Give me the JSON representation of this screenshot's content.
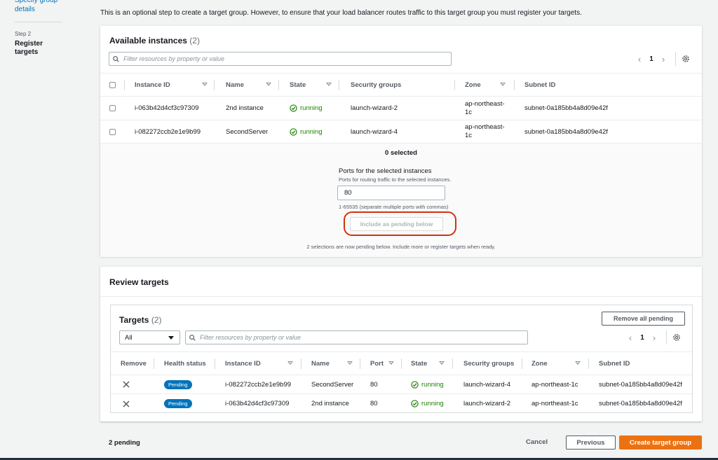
{
  "nav": {
    "prev_step_link": "Specify group details",
    "step_label": "Step 2",
    "step_name": "Register targets"
  },
  "intro_text": "This is an optional step to create a target group. However, to ensure that your load balancer routes traffic to this target group you must register your targets.",
  "available": {
    "title": "Available instances",
    "count": "(2)",
    "filter_placeholder": "Filter resources by property or value",
    "page": "1",
    "columns": [
      "Instance ID",
      "Name",
      "State",
      "Security groups",
      "Zone",
      "Subnet ID"
    ],
    "rows": [
      {
        "instance_id": "i-063b42d4cf3c97309",
        "name": "2nd instance",
        "state": "running",
        "security_group": "launch-wizard-2",
        "zone": "ap-northeast-1c",
        "subnet": "subnet-0a185bb4a8d09e42f"
      },
      {
        "instance_id": "i-082272ccb2e1e9b99",
        "name": "SecondServer",
        "state": "running",
        "security_group": "launch-wizard-4",
        "zone": "ap-northeast-1c",
        "subnet": "subnet-0a185bb4a8d09e42f"
      }
    ],
    "selected_count": "0 selected",
    "ports_label": "Ports for the selected instances",
    "ports_desc": "Ports for routing traffic to the selected instances.",
    "port_value": "80",
    "port_hint": "1-65535 (separate multiple ports with commas)",
    "include_button": "Include as pending below",
    "pending_note": "2 selections are now pending below. Include more or register targets when ready."
  },
  "review": {
    "title": "Review targets",
    "targets_title": "Targets",
    "targets_count": "(2)",
    "remove_all_button": "Remove all pending",
    "filter_select": "All",
    "filter_placeholder": "Filter resources by property or value",
    "page": "1",
    "columns": [
      "Remove",
      "Health status",
      "Instance ID",
      "Name",
      "Port",
      "State",
      "Security groups",
      "Zone",
      "Subnet ID"
    ],
    "rows": [
      {
        "health": "Pending",
        "instance_id": "i-082272ccb2e1e9b99",
        "name": "SecondServer",
        "port": "80",
        "state": "running",
        "security_group": "launch-wizard-4",
        "zone": "ap-northeast-1c",
        "subnet": "subnet-0a185bb4a8d09e42f"
      },
      {
        "health": "Pending",
        "instance_id": "i-063b42d4cf3c97309",
        "name": "2nd instance",
        "port": "80",
        "state": "running",
        "security_group": "launch-wizard-2",
        "zone": "ap-northeast-1c",
        "subnet": "subnet-0a185bb4a8d09e42f"
      }
    ]
  },
  "footer": {
    "pending_count": "2 pending",
    "cancel": "Cancel",
    "previous": "Previous",
    "create": "Create target group"
  },
  "colors": {
    "link": "#0073bb",
    "success": "#1d8102",
    "primary_button": "#ec7211",
    "highlight": "#d13212",
    "badge": "#0073bb"
  }
}
